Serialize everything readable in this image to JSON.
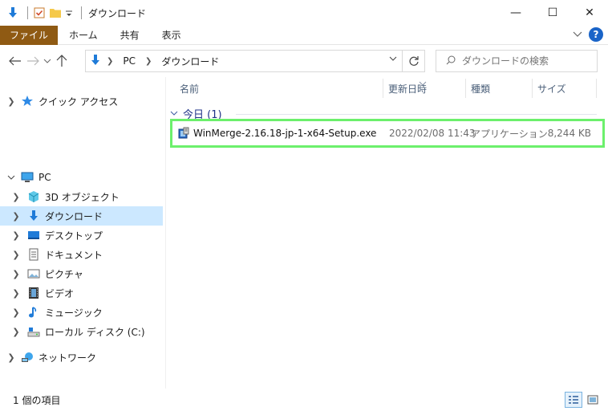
{
  "window": {
    "title": "ダウンロード"
  },
  "titlebar": {
    "minimize": "—",
    "maximize": "☐",
    "close": "✕"
  },
  "ribbon": {
    "tabs": [
      "ファイル",
      "ホーム",
      "共有",
      "表示"
    ],
    "help": "?"
  },
  "address": {
    "crumbs": [
      "PC",
      "ダウンロード"
    ]
  },
  "search": {
    "placeholder": "ダウンロードの検索"
  },
  "nav": {
    "quick_access": "クイック アクセス",
    "pc": "PC",
    "items": [
      "3D オブジェクト",
      "ダウンロード",
      "デスクトップ",
      "ドキュメント",
      "ピクチャ",
      "ビデオ",
      "ミュージック",
      "ローカル ディスク (C:)"
    ],
    "network": "ネットワーク"
  },
  "columns": {
    "name": "名前",
    "date": "更新日時",
    "type": "種類",
    "size": "サイズ"
  },
  "group": {
    "label": "今日 (1)"
  },
  "files": [
    {
      "name": "WinMerge-2.16.18-jp-1-x64-Setup.exe",
      "date": "2022/02/08 11:43",
      "type": "アプリケーション",
      "size": "8,244 KB"
    }
  ],
  "status": {
    "count": "1 個の項目"
  },
  "colors": {
    "file_tab": "#8f5a13",
    "selection": "#cce8ff",
    "highlight_border": "#6cf06c",
    "group_text": "#1e3287"
  }
}
